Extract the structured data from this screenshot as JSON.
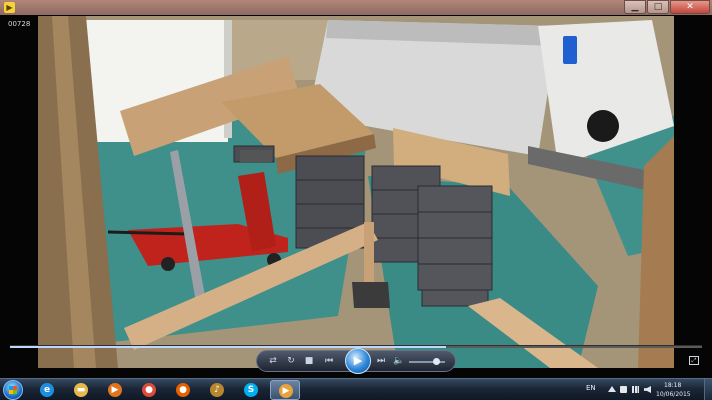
{
  "window": {
    "file_label": "00728"
  },
  "player": {
    "seek_progress": 0.63,
    "volume_level": 0.75,
    "icons": [
      "switch-to-library-icon",
      "shuffle-icon",
      "repeat-icon",
      "stop-icon",
      "previous-icon",
      "play-icon",
      "next-icon",
      "volume-icon",
      "fullscreen-icon"
    ]
  },
  "taskbar": {
    "apps": [
      {
        "name": "internet-explorer-icon",
        "color": "#1e8fe0",
        "glyph": "e"
      },
      {
        "name": "windows-explorer-icon",
        "color": "#e8b84a",
        "glyph": "▬"
      },
      {
        "name": "media-player-icon",
        "color": "#e0751e",
        "glyph": "▶"
      },
      {
        "name": "chrome-icon",
        "color": "#dd4b39",
        "glyph": "●"
      },
      {
        "name": "firefox-icon",
        "color": "#e66000",
        "glyph": "●"
      },
      {
        "name": "itunes-icon",
        "color": "#b8862c",
        "glyph": "♪"
      },
      {
        "name": "skype-icon",
        "color": "#00aff0",
        "glyph": "S"
      },
      {
        "name": "video-player-icon",
        "color": "#e8a23a",
        "glyph": "▶"
      }
    ],
    "language": "EN",
    "time": "18:18",
    "date": "10/06/2015",
    "tray_icons": [
      "show-hidden-icons-icon",
      "action-center-icon",
      "network-icon",
      "volume-tray-icon"
    ]
  },
  "colors": {
    "titlebar": "#a17a6f",
    "accent": "#2f86d7",
    "taskbar": "#1b2636"
  }
}
